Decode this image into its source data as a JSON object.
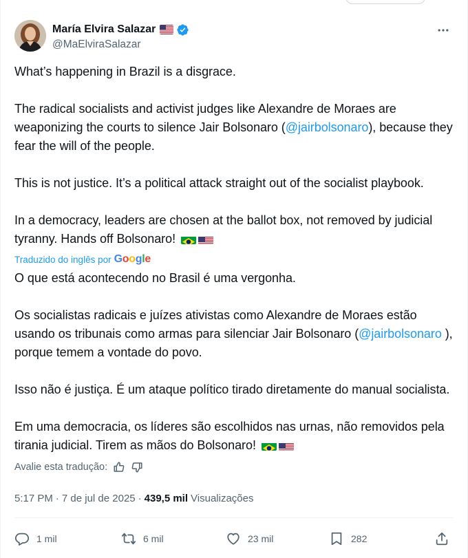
{
  "author": {
    "name": "María Elvira Salazar",
    "handle": "@MaElviraSalazar"
  },
  "original": {
    "p1": "What’s happening in Brazil is a disgrace.",
    "p2_a": "The radical socialists and activist judges like Alexandre de Moraes are weaponizing the courts to silence Jair Bolsonaro (",
    "p2_mention": "@jairbolsonaro",
    "p2_b": "), because they fear the will of the people.",
    "p3": "This is not justice. It’s a political attack straight out of the socialist playbook.",
    "p4": "In a democracy, leaders are chosen at the ballot box, not removed by judicial tyranny. Hands off Bolsonaro!"
  },
  "translation": {
    "label": "Traduzido do inglês por",
    "provider": "Google",
    "p1": "O que está acontecendo no Brasil é uma vergonha.",
    "p2_a": "Os socialistas radicais e juízes ativistas como Alexandre de Moraes estão usando os tribunais como armas para silenciar Jair Bolsonaro (",
    "p2_mention": "@jairbolsonaro",
    "p2_b": " ), porque temem a vontade do povo.",
    "p3": "Isso não é justiça. É um ataque político tirado diretamente do manual socialista.",
    "p4": "Em uma democracia, os líderes são escolhidos nas urnas, não removidos pela tirania judicial. Tirem as mãos do Bolsonaro!"
  },
  "rate_translation": {
    "label": "Avalie esta tradução:",
    "icons": [
      "thumbs-up-icon",
      "thumbs-down-icon"
    ]
  },
  "meta": {
    "time": "5:17 PM",
    "dot": "·",
    "date": "7 de jul de 2025",
    "views_count": "439,5 mil",
    "views_label": "Visualizações"
  },
  "actions": {
    "replies": "1 mil",
    "reposts": "6 mil",
    "likes": "23 mil",
    "bookmarks": "282"
  },
  "icons": {
    "verified": "verified-badge-icon",
    "more": "more-options-icon",
    "flags": [
      "brazil-flag-icon",
      "usa-flag-icon"
    ]
  },
  "colors": {
    "accent": "#1d9bf0",
    "text": "#0f1419",
    "secondary": "#536471"
  }
}
